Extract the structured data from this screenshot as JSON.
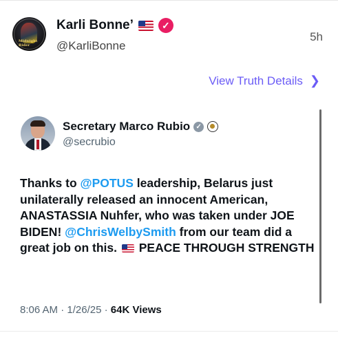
{
  "post": {
    "display_name": "Karli Bonne’",
    "handle": "@KarliBonne",
    "time": "5h",
    "avatar_text": "Midnight Rider",
    "view_details_label": "View Truth Details",
    "icons": {
      "flag": "us-flag-icon",
      "verified": "verified-badge-icon",
      "chevron": "chevron-right-icon"
    },
    "colors": {
      "verified": "#e91e63",
      "link": "#6b5cf6"
    }
  },
  "embed": {
    "name": "Secretary Marco Rubio",
    "handle": "@secrubio",
    "text": {
      "p1": "Thanks to ",
      "m1": "@POTUS",
      "p2": " leadership, Belarus just unilaterally released an innocent American, ANASTASSIA Nuhfer, who was taken under JOE BIDEN! ",
      "m2": "@ChrisWelbySmith",
      "p3": " from our team did a great job on this.",
      "p4": " PEACE THROUGH STRENGTH"
    },
    "time": "8:06 AM",
    "sep1": " · ",
    "date": "1/26/25",
    "sep2": " · ",
    "views": "64K",
    "views_label": " Views",
    "icons": {
      "verified": "gray-verified-badge-icon",
      "seal": "government-seal-icon",
      "flag": "us-flag-icon"
    },
    "colors": {
      "mention": "#1d9bf0",
      "meta": "#536471"
    }
  }
}
